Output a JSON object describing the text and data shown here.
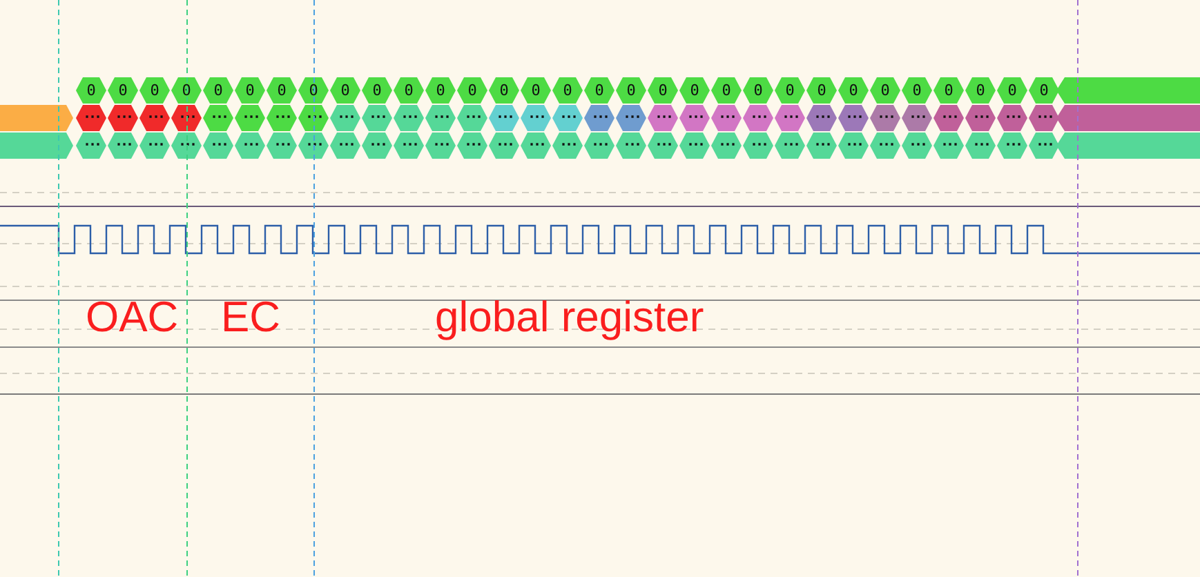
{
  "buses": [
    {
      "tail": {
        "color": "#4ddb44"
      },
      "cells": [
        {
          "value": "0",
          "color": "#4ddb44"
        },
        {
          "value": "0",
          "color": "#4ddb44"
        },
        {
          "value": "0",
          "color": "#4ddb44"
        },
        {
          "value": "0",
          "color": "#4ddb44"
        },
        {
          "value": "0",
          "color": "#4ddb44"
        },
        {
          "value": "0",
          "color": "#4ddb44"
        },
        {
          "value": "0",
          "color": "#4ddb44"
        },
        {
          "value": "0",
          "color": "#4ddb44"
        },
        {
          "value": "0",
          "color": "#4ddb44"
        },
        {
          "value": "0",
          "color": "#4ddb44"
        },
        {
          "value": "0",
          "color": "#4ddb44"
        },
        {
          "value": "0",
          "color": "#4ddb44"
        },
        {
          "value": "0",
          "color": "#4ddb44"
        },
        {
          "value": "0",
          "color": "#4ddb44"
        },
        {
          "value": "0",
          "color": "#4ddb44"
        },
        {
          "value": "0",
          "color": "#4ddb44"
        },
        {
          "value": "0",
          "color": "#4ddb44"
        },
        {
          "value": "0",
          "color": "#4ddb44"
        },
        {
          "value": "0",
          "color": "#4ddb44"
        },
        {
          "value": "0",
          "color": "#4ddb44"
        },
        {
          "value": "0",
          "color": "#4ddb44"
        },
        {
          "value": "0",
          "color": "#4ddb44"
        },
        {
          "value": "0",
          "color": "#4ddb44"
        },
        {
          "value": "0",
          "color": "#4ddb44"
        },
        {
          "value": "0",
          "color": "#4ddb44"
        },
        {
          "value": "0",
          "color": "#4ddb44"
        },
        {
          "value": "0",
          "color": "#4ddb44"
        },
        {
          "value": "0",
          "color": "#4ddb44"
        },
        {
          "value": "0",
          "color": "#4ddb44"
        },
        {
          "value": "0",
          "color": "#4ddb44"
        },
        {
          "value": "0",
          "color": "#4ddb44"
        }
      ]
    },
    {
      "lead": {
        "color": "#fbad45"
      },
      "tail": {
        "color": "#c0609a"
      },
      "cells": [
        {
          "value": "···",
          "color": "#f02a2a"
        },
        {
          "value": "···",
          "color": "#f02a2a"
        },
        {
          "value": "···",
          "color": "#f02a2a"
        },
        {
          "value": "···",
          "color": "#f02a2a"
        },
        {
          "value": "···",
          "color": "#4ddb44"
        },
        {
          "value": "···",
          "color": "#4ddb44"
        },
        {
          "value": "···",
          "color": "#4ddb44"
        },
        {
          "value": "···",
          "color": "#4ddb44"
        },
        {
          "value": "···",
          "color": "#55d898"
        },
        {
          "value": "···",
          "color": "#55d898"
        },
        {
          "value": "···",
          "color": "#55d898"
        },
        {
          "value": "···",
          "color": "#55d898"
        },
        {
          "value": "···",
          "color": "#55d898"
        },
        {
          "value": "···",
          "color": "#63d0d0"
        },
        {
          "value": "···",
          "color": "#63d0d0"
        },
        {
          "value": "···",
          "color": "#63d0d0"
        },
        {
          "value": "···",
          "color": "#6f9ccf"
        },
        {
          "value": "···",
          "color": "#6f9ccf"
        },
        {
          "value": "···",
          "color": "#d276c4"
        },
        {
          "value": "···",
          "color": "#d276c4"
        },
        {
          "value": "···",
          "color": "#d276c4"
        },
        {
          "value": "···",
          "color": "#d276c4"
        },
        {
          "value": "···",
          "color": "#d276c4"
        },
        {
          "value": "···",
          "color": "#9c78b8"
        },
        {
          "value": "···",
          "color": "#9c78b8"
        },
        {
          "value": "···",
          "color": "#ac7aa8"
        },
        {
          "value": "···",
          "color": "#ac7aa8"
        },
        {
          "value": "···",
          "color": "#c0609a"
        },
        {
          "value": "···",
          "color": "#c0609a"
        },
        {
          "value": "···",
          "color": "#c0609a"
        },
        {
          "value": "···",
          "color": "#c0609a"
        }
      ]
    },
    {
      "lead": {
        "color": "#55d898"
      },
      "tail": {
        "color": "#55d898"
      },
      "cells": [
        {
          "value": "···",
          "color": "#55d898"
        },
        {
          "value": "···",
          "color": "#55d898"
        },
        {
          "value": "···",
          "color": "#55d898"
        },
        {
          "value": "···",
          "color": "#55d898"
        },
        {
          "value": "···",
          "color": "#55d898"
        },
        {
          "value": "···",
          "color": "#55d898"
        },
        {
          "value": "···",
          "color": "#55d898"
        },
        {
          "value": "···",
          "color": "#55d898"
        },
        {
          "value": "···",
          "color": "#55d898"
        },
        {
          "value": "···",
          "color": "#55d898"
        },
        {
          "value": "···",
          "color": "#55d898"
        },
        {
          "value": "···",
          "color": "#55d898"
        },
        {
          "value": "···",
          "color": "#55d898"
        },
        {
          "value": "···",
          "color": "#55d898"
        },
        {
          "value": "···",
          "color": "#55d898"
        },
        {
          "value": "···",
          "color": "#55d898"
        },
        {
          "value": "···",
          "color": "#55d898"
        },
        {
          "value": "···",
          "color": "#55d898"
        },
        {
          "value": "···",
          "color": "#55d898"
        },
        {
          "value": "···",
          "color": "#55d898"
        },
        {
          "value": "···",
          "color": "#55d898"
        },
        {
          "value": "···",
          "color": "#55d898"
        },
        {
          "value": "···",
          "color": "#55d898"
        },
        {
          "value": "···",
          "color": "#55d898"
        },
        {
          "value": "···",
          "color": "#55d898"
        },
        {
          "value": "···",
          "color": "#55d898"
        },
        {
          "value": "···",
          "color": "#55d898"
        },
        {
          "value": "···",
          "color": "#55d898"
        },
        {
          "value": "···",
          "color": "#55d898"
        },
        {
          "value": "···",
          "color": "#55d898"
        },
        {
          "value": "···",
          "color": "#55d898"
        }
      ]
    }
  ],
  "cursors": [
    {
      "color": "#3cc8b0"
    },
    {
      "color": "#3cd080"
    },
    {
      "color": "#4aa0e0"
    },
    {
      "color": "#a070d0"
    }
  ],
  "annotations": [
    {
      "text": "OAC"
    },
    {
      "text": "EC"
    },
    {
      "text": "global register"
    }
  ]
}
